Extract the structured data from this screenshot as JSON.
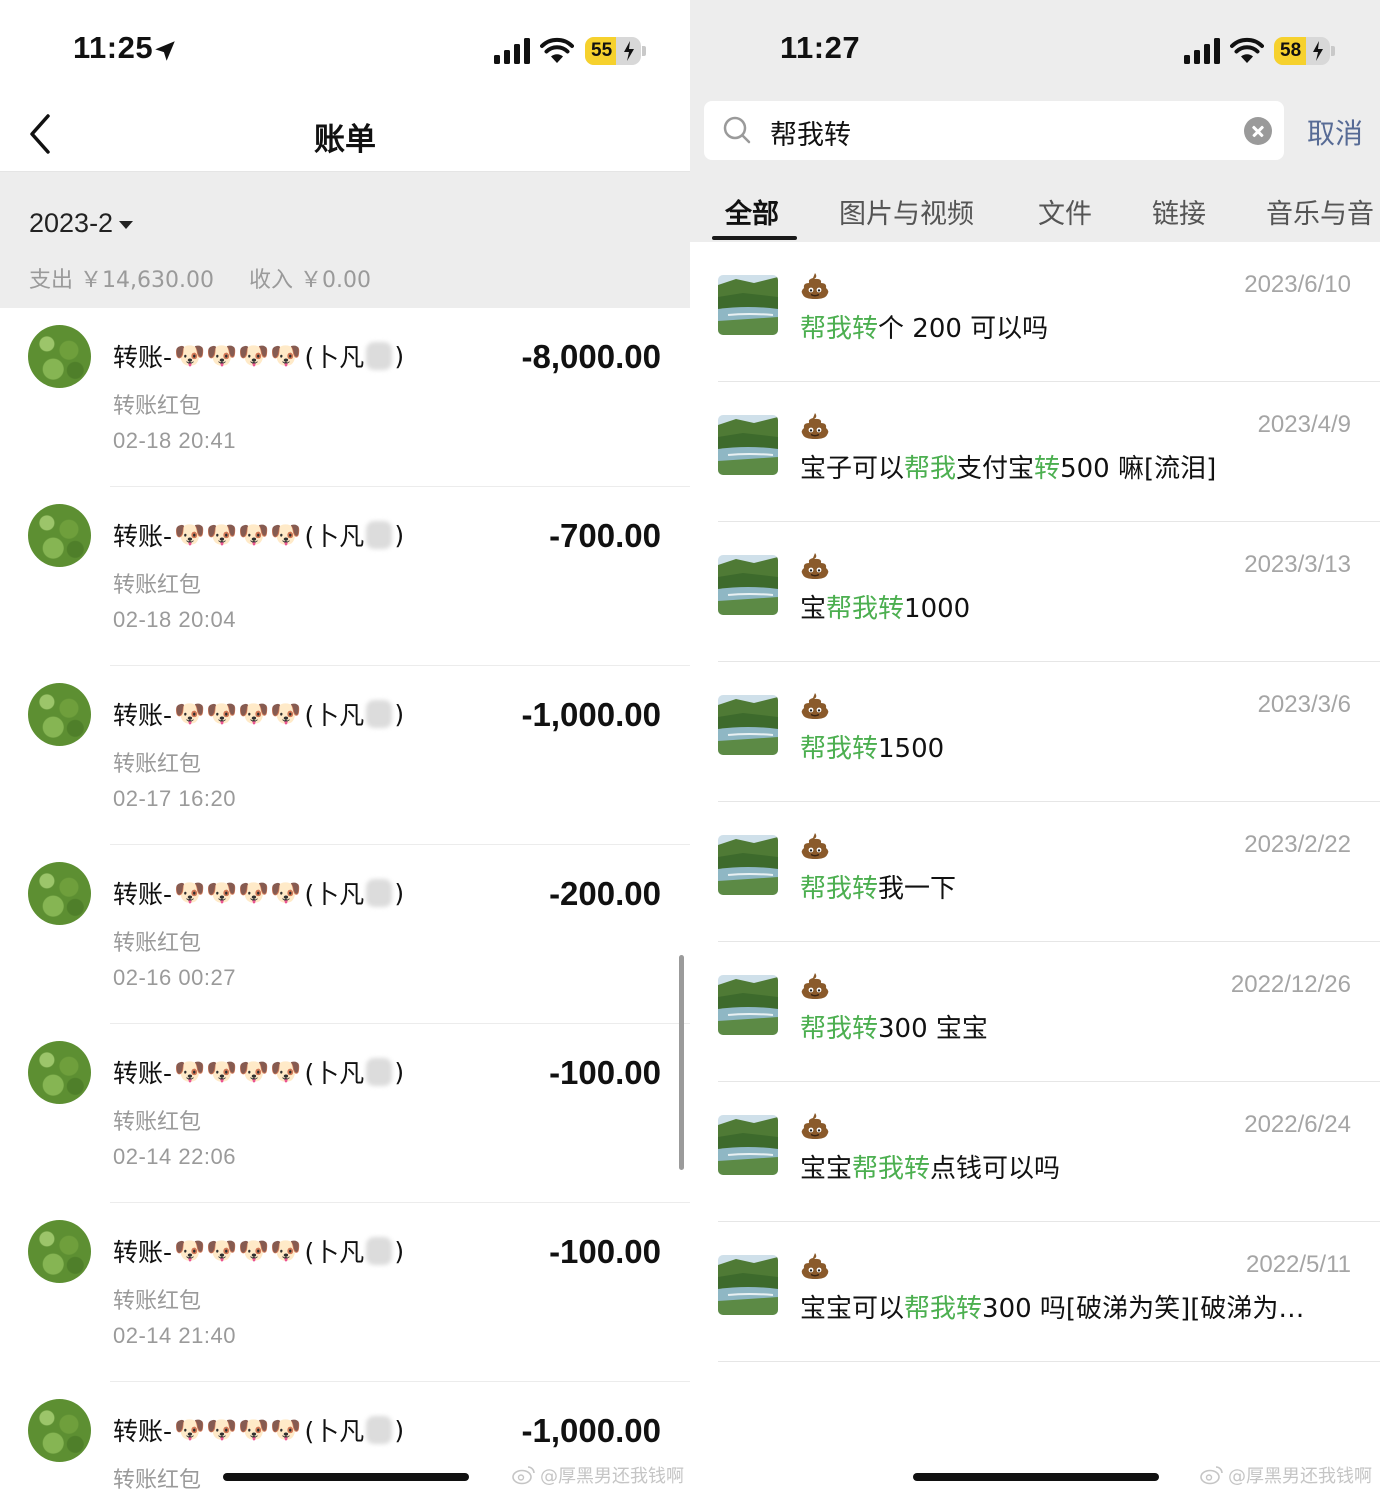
{
  "left": {
    "status": {
      "time": "11:25",
      "battery": "55",
      "battery_level": 0.55
    },
    "nav": {
      "title": "账单"
    },
    "month": {
      "label": "2023-2"
    },
    "summary": {
      "expense": "支出 ￥14,630.00",
      "income": "收入 ￥0.00"
    },
    "bills": [
      {
        "prefix": "转账-",
        "dogs": "🐶🐶🐶🐶",
        "name": "(卜凡",
        "suffix": ")",
        "type": "转账红包",
        "time": "02-18  20:41",
        "amount": "-8,000.00"
      },
      {
        "prefix": "转账-",
        "dogs": "🐶🐶🐶🐶",
        "name": "(卜凡",
        "suffix": ")",
        "type": "转账红包",
        "time": "02-18  20:04",
        "amount": "-700.00"
      },
      {
        "prefix": "转账-",
        "dogs": "🐶🐶🐶🐶",
        "name": "(卜凡",
        "suffix": ")",
        "type": "转账红包",
        "time": "02-17  16:20",
        "amount": "-1,000.00"
      },
      {
        "prefix": "转账-",
        "dogs": "🐶🐶🐶🐶",
        "name": "(卜凡",
        "suffix": ")",
        "type": "转账红包",
        "time": "02-16  00:27",
        "amount": "-200.00"
      },
      {
        "prefix": "转账-",
        "dogs": "🐶🐶🐶🐶",
        "name": "(卜凡",
        "suffix": ")",
        "type": "转账红包",
        "time": "02-14  22:06",
        "amount": "-100.00"
      },
      {
        "prefix": "转账-",
        "dogs": "🐶🐶🐶🐶",
        "name": "(卜凡",
        "suffix": ")",
        "type": "转账红包",
        "time": "02-14  21:40",
        "amount": "-100.00"
      },
      {
        "prefix": "转账-",
        "dogs": "🐶🐶🐶🐶",
        "name": "(卜凡",
        "suffix": ")",
        "type": "转账红包",
        "time": "",
        "amount": "-1,000.00"
      }
    ],
    "watermark": "@厚黑男还我钱啊"
  },
  "right": {
    "status": {
      "time": "11:27",
      "battery": "58",
      "battery_level": 0.58
    },
    "search": {
      "query": "帮我转",
      "cancel": "取消"
    },
    "tabs": [
      "全部",
      "图片与视频",
      "文件",
      "链接",
      "音乐与音"
    ],
    "results": [
      {
        "date": "2023/6/10",
        "parts": [
          {
            "t": "帮我转",
            "h": true
          },
          {
            "t": "个 200 可以吗",
            "h": false
          }
        ]
      },
      {
        "date": "2023/4/9",
        "parts": [
          {
            "t": "宝子可以",
            "h": false
          },
          {
            "t": "帮我",
            "h": true
          },
          {
            "t": "支付宝",
            "h": false
          },
          {
            "t": "转",
            "h": true
          },
          {
            "t": "500 嘛[流泪]",
            "h": false
          }
        ]
      },
      {
        "date": "2023/3/13",
        "parts": [
          {
            "t": "宝",
            "h": false
          },
          {
            "t": "帮我转",
            "h": true
          },
          {
            "t": "1000",
            "h": false
          }
        ]
      },
      {
        "date": "2023/3/6",
        "parts": [
          {
            "t": "帮我转",
            "h": true
          },
          {
            "t": "1500",
            "h": false
          }
        ]
      },
      {
        "date": "2023/2/22",
        "parts": [
          {
            "t": "帮我转",
            "h": true
          },
          {
            "t": "我一下",
            "h": false
          }
        ]
      },
      {
        "date": "2022/12/26",
        "parts": [
          {
            "t": "帮我转",
            "h": true
          },
          {
            "t": "300 宝宝",
            "h": false
          }
        ]
      },
      {
        "date": "2022/6/24",
        "parts": [
          {
            "t": "宝宝",
            "h": false
          },
          {
            "t": "帮我转",
            "h": true
          },
          {
            "t": "点钱可以吗",
            "h": false
          }
        ]
      },
      {
        "date": "2022/5/11",
        "parts": [
          {
            "t": "宝宝可以",
            "h": false
          },
          {
            "t": "帮我转",
            "h": true
          },
          {
            "t": "300 吗[破涕为笑][破涕为…",
            "h": false
          }
        ]
      }
    ],
    "watermark": "@厚黑男还我钱啊"
  },
  "colors": {
    "highlight": "#4caf50",
    "link": "#576b95",
    "battery": "#f6d12d"
  },
  "icons": {
    "back": "chevron-left-icon",
    "search": "search-icon",
    "clear": "clear-icon",
    "signal": "signal-icon",
    "wifi": "wifi-icon",
    "location": "location-arrow-icon",
    "sender": "poop-icon"
  }
}
